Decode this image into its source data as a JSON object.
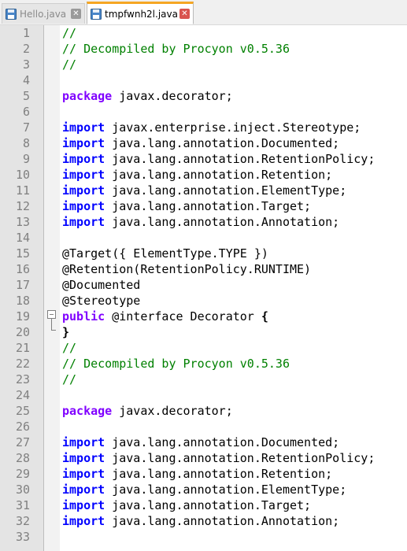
{
  "tabs": [
    {
      "label": "Hello.java",
      "active": false,
      "icon": "save-disk-icon"
    },
    {
      "label": "tmpfwnh2l.java",
      "active": true,
      "icon": "save-disk-icon"
    }
  ],
  "colors": {
    "keyword": "#8000ff",
    "import_keyword": "#0000ff",
    "comment": "#008000",
    "active_tab_accent": "#f5a623"
  },
  "lines": [
    {
      "n": "1",
      "parts": [
        {
          "t": "//",
          "c": "cm"
        }
      ]
    },
    {
      "n": "2",
      "parts": [
        {
          "t": "// Decompiled by Procyon v0.5.36",
          "c": "cm"
        }
      ]
    },
    {
      "n": "3",
      "parts": [
        {
          "t": "//",
          "c": "cm"
        }
      ]
    },
    {
      "n": "4",
      "parts": []
    },
    {
      "n": "5",
      "parts": [
        {
          "t": "package",
          "c": "kw"
        },
        {
          "t": " javax.decorator;",
          "c": ""
        }
      ]
    },
    {
      "n": "6",
      "parts": []
    },
    {
      "n": "7",
      "parts": [
        {
          "t": "import",
          "c": "kw-import"
        },
        {
          "t": " javax.enterprise.inject.Stereotype;",
          "c": ""
        }
      ]
    },
    {
      "n": "8",
      "parts": [
        {
          "t": "import",
          "c": "kw-import"
        },
        {
          "t": " java.lang.annotation.Documented;",
          "c": ""
        }
      ]
    },
    {
      "n": "9",
      "parts": [
        {
          "t": "import",
          "c": "kw-import"
        },
        {
          "t": " java.lang.annotation.RetentionPolicy;",
          "c": ""
        }
      ]
    },
    {
      "n": "10",
      "parts": [
        {
          "t": "import",
          "c": "kw-import"
        },
        {
          "t": " java.lang.annotation.Retention;",
          "c": ""
        }
      ]
    },
    {
      "n": "11",
      "parts": [
        {
          "t": "import",
          "c": "kw-import"
        },
        {
          "t": " java.lang.annotation.ElementType;",
          "c": ""
        }
      ]
    },
    {
      "n": "12",
      "parts": [
        {
          "t": "import",
          "c": "kw-import"
        },
        {
          "t": " java.lang.annotation.Target;",
          "c": ""
        }
      ]
    },
    {
      "n": "13",
      "parts": [
        {
          "t": "import",
          "c": "kw-import"
        },
        {
          "t": " java.lang.annotation.Annotation;",
          "c": ""
        }
      ]
    },
    {
      "n": "14",
      "parts": []
    },
    {
      "n": "15",
      "parts": [
        {
          "t": "@Target({ ElementType.TYPE })",
          "c": ""
        }
      ]
    },
    {
      "n": "16",
      "parts": [
        {
          "t": "@Retention(RetentionPolicy.RUNTIME)",
          "c": ""
        }
      ]
    },
    {
      "n": "17",
      "parts": [
        {
          "t": "@Documented",
          "c": ""
        }
      ]
    },
    {
      "n": "18",
      "parts": [
        {
          "t": "@Stereotype",
          "c": ""
        }
      ]
    },
    {
      "n": "19",
      "parts": [
        {
          "t": "public",
          "c": "kw"
        },
        {
          "t": " @interface Decorator ",
          "c": ""
        },
        {
          "t": "{",
          "c": "brace"
        }
      ]
    },
    {
      "n": "20",
      "parts": [
        {
          "t": "}",
          "c": "brace"
        }
      ]
    },
    {
      "n": "21",
      "parts": [
        {
          "t": "//",
          "c": "cm"
        }
      ]
    },
    {
      "n": "22",
      "parts": [
        {
          "t": "// Decompiled by Procyon v0.5.36",
          "c": "cm"
        }
      ]
    },
    {
      "n": "23",
      "parts": [
        {
          "t": "//",
          "c": "cm"
        }
      ]
    },
    {
      "n": "24",
      "parts": []
    },
    {
      "n": "25",
      "parts": [
        {
          "t": "package",
          "c": "kw"
        },
        {
          "t": " javax.decorator;",
          "c": ""
        }
      ]
    },
    {
      "n": "26",
      "parts": []
    },
    {
      "n": "27",
      "parts": [
        {
          "t": "import",
          "c": "kw-import"
        },
        {
          "t": " java.lang.annotation.Documented;",
          "c": ""
        }
      ]
    },
    {
      "n": "28",
      "parts": [
        {
          "t": "import",
          "c": "kw-import"
        },
        {
          "t": " java.lang.annotation.RetentionPolicy;",
          "c": ""
        }
      ]
    },
    {
      "n": "29",
      "parts": [
        {
          "t": "import",
          "c": "kw-import"
        },
        {
          "t": " java.lang.annotation.Retention;",
          "c": ""
        }
      ]
    },
    {
      "n": "30",
      "parts": [
        {
          "t": "import",
          "c": "kw-import"
        },
        {
          "t": " java.lang.annotation.ElementType;",
          "c": ""
        }
      ]
    },
    {
      "n": "31",
      "parts": [
        {
          "t": "import",
          "c": "kw-import"
        },
        {
          "t": " java.lang.annotation.Target;",
          "c": ""
        }
      ]
    },
    {
      "n": "32",
      "parts": [
        {
          "t": "import",
          "c": "kw-import"
        },
        {
          "t": " java.lang.annotation.Annotation;",
          "c": ""
        }
      ]
    },
    {
      "n": "33",
      "parts": []
    }
  ]
}
